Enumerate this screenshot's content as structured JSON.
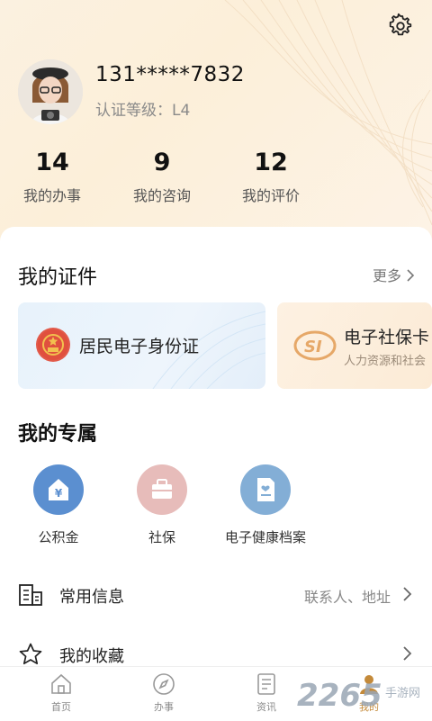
{
  "profile": {
    "phone": "131*****7832",
    "level_label": "认证等级：",
    "level_value": "L4"
  },
  "stats": [
    {
      "value": "14",
      "label": "我的办事"
    },
    {
      "value": "9",
      "label": "我的咨询"
    },
    {
      "value": "12",
      "label": "我的评价"
    }
  ],
  "certificates": {
    "title": "我的证件",
    "more": "更多",
    "cards": [
      {
        "title": "居民电子身份证",
        "subtitle": ""
      },
      {
        "title": "电子社保卡",
        "subtitle": "人力资源和社会"
      }
    ]
  },
  "exclusive": {
    "title": "我的专属",
    "items": [
      {
        "label": "公积金",
        "icon": "house-yuan-icon",
        "color": "#5b8fd0"
      },
      {
        "label": "社保",
        "icon": "briefcase-icon",
        "color": "#e2b0ae"
      },
      {
        "label": "电子健康档案",
        "icon": "health-document-icon",
        "color": "#78a8d4"
      }
    ]
  },
  "rows": [
    {
      "label": "常用信息",
      "value": "联系人、地址",
      "icon": "building-icon"
    },
    {
      "label": "我的收藏",
      "value": "",
      "icon": "star-icon"
    }
  ],
  "tabs": [
    {
      "label": "首页",
      "icon": "home-icon"
    },
    {
      "label": "办事",
      "icon": "compass-icon"
    },
    {
      "label": "资讯",
      "icon": "news-icon"
    },
    {
      "label": "我的",
      "icon": "profile-icon",
      "active": true
    }
  ],
  "watermark": "2265 手游网",
  "colors": {
    "accent": "#c48a3a",
    "header_bg": "#fbf1e0",
    "card_blue": "#e7f2fb",
    "card_orange": "#fdf1e2"
  }
}
